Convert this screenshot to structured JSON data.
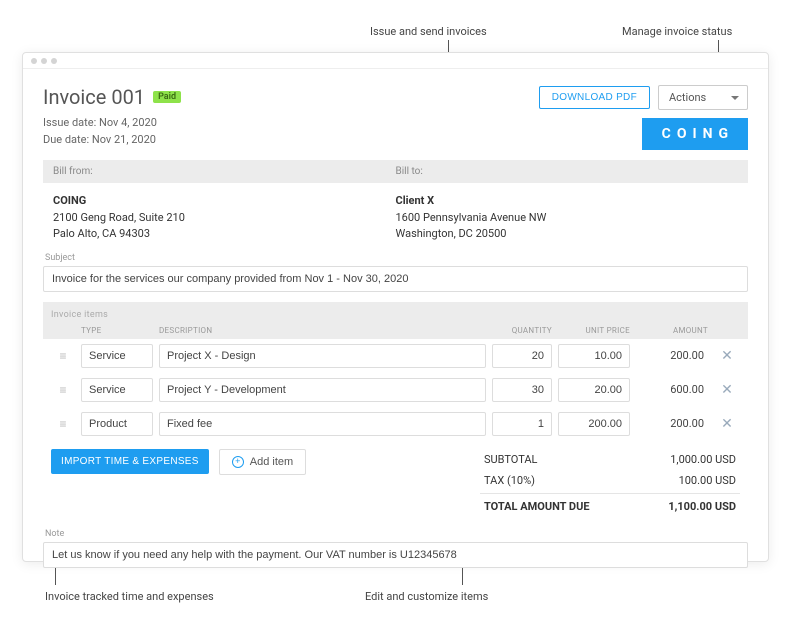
{
  "annotations": {
    "issue_send": "Issue and send invoices",
    "manage_status": "Manage invoice status",
    "invoice_tracked": "Invoice tracked time and expenses",
    "edit_items": "Edit and customize items"
  },
  "header": {
    "title": "Invoice 001",
    "badge": "Paid",
    "issue_date_label": "Issue date: Nov 4, 2020",
    "due_date_label": "Due date: Nov 21, 2020",
    "download_label": "DOWNLOAD PDF",
    "actions_label": "Actions",
    "brand": "COING"
  },
  "bill": {
    "from_label": "Bill from:",
    "to_label": "Bill to:",
    "from": {
      "name": "COING",
      "line1": "2100 Geng Road, Suite 210",
      "line2": "Palo Alto, CA 94303"
    },
    "to": {
      "name": "Client X",
      "line1": "1600 Pennsylvania Avenue NW",
      "line2": "Washington, DC 20500"
    }
  },
  "subject": {
    "label": "Subject",
    "value": "Invoice for the services our company provided from Nov 1 - Nov 30, 2020"
  },
  "items_header": {
    "title": "Invoice items",
    "type": "TYPE",
    "description": "DESCRIPTION",
    "quantity": "QUANTITY",
    "unit_price": "UNIT PRICE",
    "amount": "AMOUNT"
  },
  "items": [
    {
      "type": "Service",
      "description": "Project X - Design",
      "quantity": "20",
      "unit_price": "10.00",
      "amount": "200.00"
    },
    {
      "type": "Service",
      "description": "Project Y - Development",
      "quantity": "30",
      "unit_price": "20.00",
      "amount": "600.00"
    },
    {
      "type": "Product",
      "description": "Fixed fee",
      "quantity": "1",
      "unit_price": "200.00",
      "amount": "200.00"
    }
  ],
  "buttons": {
    "import": "IMPORT TIME & EXPENSES",
    "add_item": "Add item"
  },
  "totals": {
    "subtotal_label": "SUBTOTAL",
    "subtotal_value": "1,000.00 USD",
    "tax_label": "TAX  (10%)",
    "tax_value": "100.00 USD",
    "total_label": "TOTAL AMOUNT DUE",
    "total_value": "1,100.00 USD"
  },
  "note": {
    "label": "Note",
    "value": "Let us know if you need any help with the payment. Our VAT number is U12345678"
  }
}
